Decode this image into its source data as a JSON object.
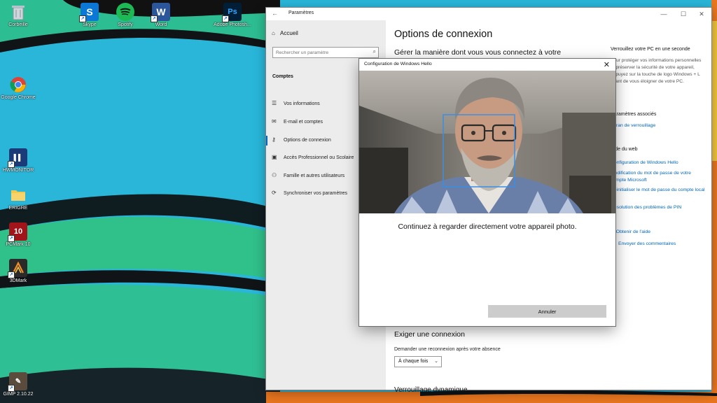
{
  "desktop": {
    "icons": [
      {
        "label": "Corbeille",
        "icon": "recycle-bin-icon",
        "color": "#8f9aa5"
      },
      {
        "label": "Skype",
        "icon": "skype-icon",
        "color": "#0a78d4"
      },
      {
        "label": "Spotify",
        "icon": "spotify-icon",
        "color": "#1db954"
      },
      {
        "label": "Word",
        "icon": "word-icon",
        "color": "#2b579a"
      },
      {
        "label": "Adobe Photosh...",
        "icon": "photoshop-icon",
        "color": "#001e36"
      },
      {
        "label": "Google Chrome",
        "icon": "chrome-icon",
        "color": "#ffffff"
      },
      {
        "label": "HWMONITOR",
        "icon": "hwmonitor-icon",
        "color": "#1b3a78"
      },
      {
        "label": "ERIGRE",
        "icon": "folder-icon",
        "color": "#f2c94c"
      },
      {
        "label": "PCMark 10",
        "icon": "pcmark-icon",
        "color": "#a1141a"
      },
      {
        "label": "3DMark",
        "icon": "3dmark-icon",
        "color": "#2a2a2a"
      },
      {
        "label": "GIMP 2.10.22",
        "icon": "gimp-icon",
        "color": "#5a4b3c"
      }
    ]
  },
  "settings": {
    "title": "Paramètres",
    "nav": {
      "home": "Accueil",
      "search_placeholder": "Rechercher un paramètre",
      "section": "Comptes",
      "items": [
        {
          "label": "Vos informations",
          "icon": "person-card-icon"
        },
        {
          "label": "E-mail et comptes",
          "icon": "mail-icon"
        },
        {
          "label": "Options de connexion",
          "icon": "key-icon",
          "active": true
        },
        {
          "label": "Accès Professionnel ou Scolaire",
          "icon": "briefcase-icon"
        },
        {
          "label": "Famille et autres utilisateurs",
          "icon": "people-icon"
        },
        {
          "label": "Synchroniser vos paramètres",
          "icon": "sync-icon"
        }
      ]
    },
    "main": {
      "heading": "Options de connexion",
      "subheading": "Gérer la manière dont vous vous connectez à votre",
      "require_heading": "Exiger une connexion",
      "require_label": "Demander une reconnexion après votre absence",
      "require_value": "À chaque fois",
      "next_heading_partial": "Verrouillage dynamique"
    },
    "side": {
      "lock_title": "Verrouillez votre PC en une seconde",
      "lock_text": "Pour protéger vos informations personnelles et préserver la sécurité de votre appareil, appuyez sur la touche de logo Windows + L avant de vous éloigner de votre PC.",
      "related_heading": "Paramètres associés",
      "related_link": "Écran de verrouillage",
      "web_heading": "Aide du web",
      "web_links": [
        "Configuration de Windows Hello",
        "Modification du mot de passe de votre compte Microsoft",
        "Réinitialiser le mot de passe du compte local",
        "Résolution des problèmes de PIN"
      ],
      "help_link": "Obtenir de l'aide",
      "feedback_link": "Envoyer des commentaires"
    }
  },
  "hello": {
    "title": "Configuration de Windows Hello",
    "message": "Continuez à regarder directement votre appareil photo.",
    "cancel": "Annuler"
  },
  "colors": {
    "accent": "#0067c0",
    "face_box": "#3b8fe0"
  }
}
